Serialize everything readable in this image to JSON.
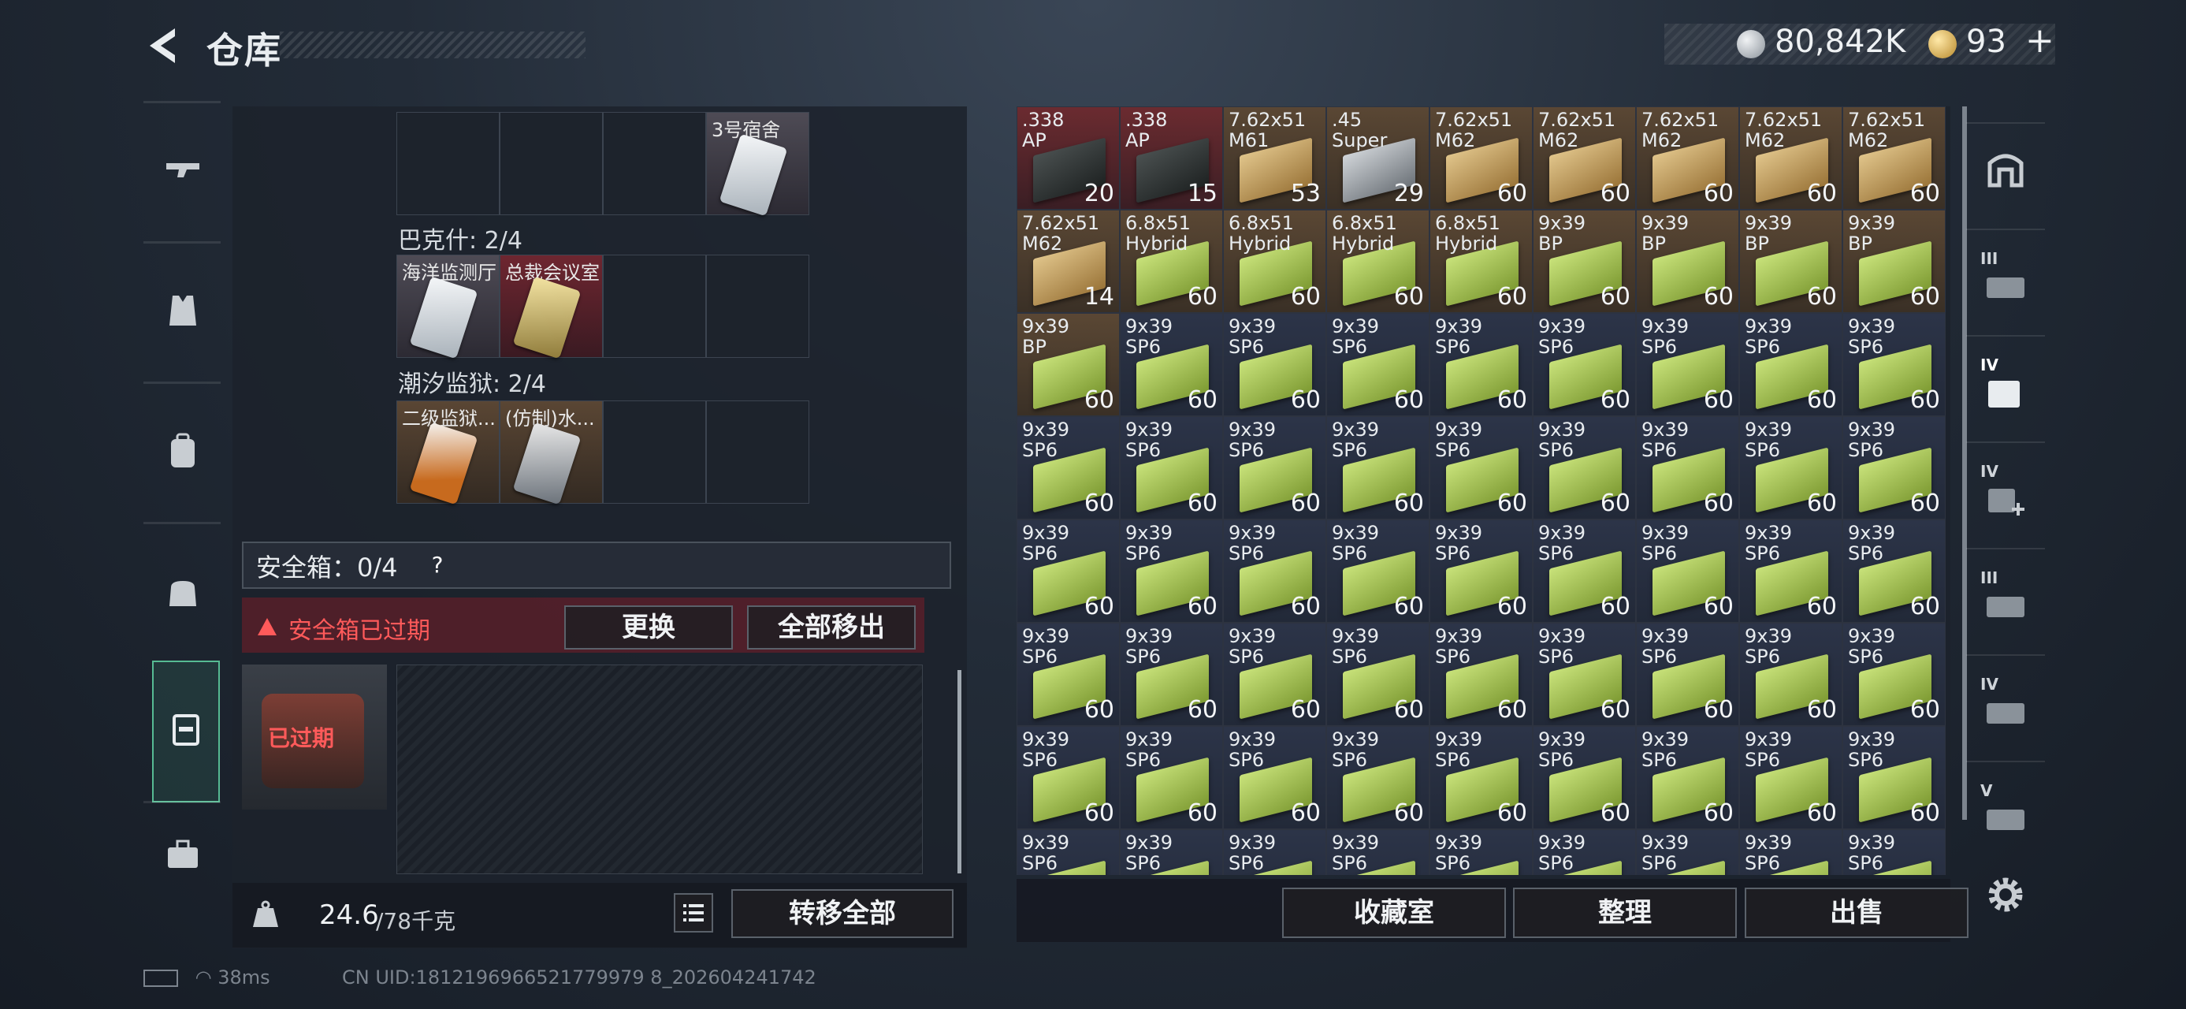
{
  "header": {
    "title": "仓库",
    "currency_silver": "80,842K",
    "currency_gold": "93",
    "add_label": "+"
  },
  "left": {
    "top_row": [
      "",
      "",
      "",
      "3号宿舍"
    ],
    "groups": [
      {
        "label": "巴克什: 2/4",
        "items": [
          "海洋监测厅",
          "总裁会议室",
          "",
          ""
        ]
      },
      {
        "label": "潮汐监狱: 2/4",
        "items": [
          "二级监狱...",
          "(仿制)水...",
          "",
          ""
        ]
      }
    ],
    "safe_label": "安全箱：0/4",
    "safe_help": "?",
    "expired_warning": "安全箱已过期",
    "change_button": "更换",
    "move_all_button": "全部移出",
    "case_status": "已过期",
    "weight_value": "24.6",
    "weight_max": "/78千克",
    "transfer_all_button": "转移全部"
  },
  "right_buttons": {
    "collection": "收藏室",
    "sort": "整理",
    "sell": "出售"
  },
  "grid": [
    {
      "c1": ".338",
      "c2": "AP",
      "count": "20",
      "tone": "red",
      "box": "dark"
    },
    {
      "c1": ".338",
      "c2": "AP",
      "count": "15",
      "tone": "red",
      "box": "dark"
    },
    {
      "c1": "7.62x51",
      "c2": "M61",
      "count": "53",
      "tone": "brown",
      "box": "tan"
    },
    {
      "c1": ".45",
      "c2": "Super",
      "count": "29",
      "tone": "brown",
      "box": "silver"
    },
    {
      "c1": "7.62x51",
      "c2": "M62",
      "count": "60",
      "tone": "brown",
      "box": "tan"
    },
    {
      "c1": "7.62x51",
      "c2": "M62",
      "count": "60",
      "tone": "brown",
      "box": "tan"
    },
    {
      "c1": "7.62x51",
      "c2": "M62",
      "count": "60",
      "tone": "brown",
      "box": "tan"
    },
    {
      "c1": "7.62x51",
      "c2": "M62",
      "count": "60",
      "tone": "brown",
      "box": "tan"
    },
    {
      "c1": "7.62x51",
      "c2": "M62",
      "count": "60",
      "tone": "brown",
      "box": "tan"
    },
    {
      "c1": "7.62x51",
      "c2": "M62",
      "count": "14",
      "tone": "brown",
      "box": "tan"
    },
    {
      "c1": "6.8x51",
      "c2": "Hybrid",
      "count": "60",
      "tone": "brown",
      "box": "green"
    },
    {
      "c1": "6.8x51",
      "c2": "Hybrid",
      "count": "60",
      "tone": "brown",
      "box": "green"
    },
    {
      "c1": "6.8x51",
      "c2": "Hybrid",
      "count": "60",
      "tone": "brown",
      "box": "green"
    },
    {
      "c1": "6.8x51",
      "c2": "Hybrid",
      "count": "60",
      "tone": "brown",
      "box": "green"
    },
    {
      "c1": "9x39",
      "c2": "BP",
      "count": "60",
      "tone": "brown",
      "box": "green"
    },
    {
      "c1": "9x39",
      "c2": "BP",
      "count": "60",
      "tone": "brown",
      "box": "green"
    },
    {
      "c1": "9x39",
      "c2": "BP",
      "count": "60",
      "tone": "brown",
      "box": "green"
    },
    {
      "c1": "9x39",
      "c2": "BP",
      "count": "60",
      "tone": "brown",
      "box": "green"
    },
    {
      "c1": "9x39",
      "c2": "BP",
      "count": "60",
      "tone": "brown",
      "box": "green"
    },
    {
      "c1": "9x39",
      "c2": "SP6",
      "count": "60",
      "tone": "blue",
      "box": "green"
    },
    {
      "c1": "9x39",
      "c2": "SP6",
      "count": "60",
      "tone": "blue",
      "box": "green"
    },
    {
      "c1": "9x39",
      "c2": "SP6",
      "count": "60",
      "tone": "blue",
      "box": "green"
    },
    {
      "c1": "9x39",
      "c2": "SP6",
      "count": "60",
      "tone": "blue",
      "box": "green"
    },
    {
      "c1": "9x39",
      "c2": "SP6",
      "count": "60",
      "tone": "blue",
      "box": "green"
    },
    {
      "c1": "9x39",
      "c2": "SP6",
      "count": "60",
      "tone": "blue",
      "box": "green"
    },
    {
      "c1": "9x39",
      "c2": "SP6",
      "count": "60",
      "tone": "blue",
      "box": "green"
    },
    {
      "c1": "9x39",
      "c2": "SP6",
      "count": "60",
      "tone": "blue",
      "box": "green"
    }
  ],
  "grid_fill": {
    "c1": "9x39",
    "c2": "SP6",
    "count": "60",
    "tone": "blue",
    "box": "green"
  },
  "status": {
    "ping": "38ms",
    "uid": "CN UID:1812196966521779979 8_202604241742"
  },
  "colors": {
    "accent_green": "#46b48c",
    "warning_red": "#ff5a5a"
  }
}
